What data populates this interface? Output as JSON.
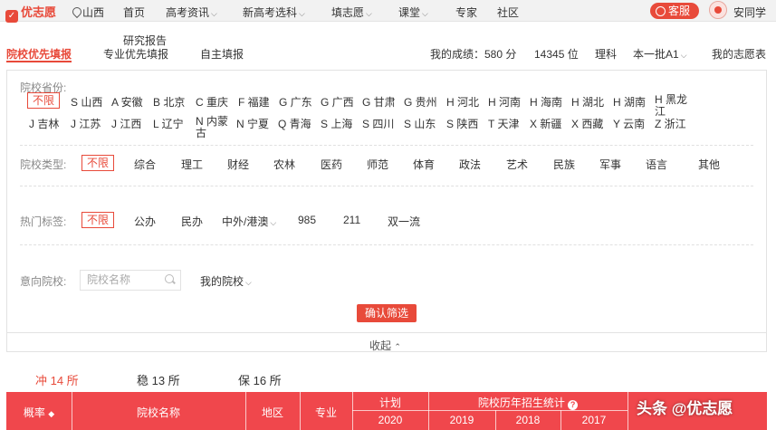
{
  "topbar": {
    "logo": "优志愿",
    "location": "山西",
    "nav": [
      {
        "label": "首页",
        "dropdown": false
      },
      {
        "label": "高考资讯",
        "dropdown": true
      },
      {
        "label": "新高考选科",
        "dropdown": true
      },
      {
        "label": "填志愿",
        "dropdown": true
      },
      {
        "label": "课堂",
        "dropdown": true
      },
      {
        "label": "专家",
        "dropdown": false
      },
      {
        "label": "社区",
        "dropdown": false
      }
    ],
    "service": "客服",
    "username": "安同学"
  },
  "tabs": {
    "school_first": "院校优先填报",
    "major_first_top": "研究报告",
    "major_first": "专业优先填报",
    "self_fill": "自主填报"
  },
  "info": {
    "score": "我的成绩：580 分",
    "rank": "14345 位",
    "subject": "理科",
    "batch": "本一批A1",
    "my_volunteer": "我的志愿表"
  },
  "filter": {
    "province_label": "院校省份:",
    "unlimited": "不限",
    "provinces_row1": [
      "S 山西",
      "A 安徽",
      "B 北京",
      "C 重庆",
      "F 福建",
      "G 广东",
      "G 广西",
      "G 甘肃",
      "G 贵州",
      "H 河北",
      "H 河南",
      "H 海南",
      "H 湖北",
      "H 湖南",
      "H 黑龙江"
    ],
    "provinces_row2": [
      "J 吉林",
      "J 江苏",
      "J 江西",
      "L 辽宁",
      "N 内蒙古",
      "N 宁夏",
      "Q 青海",
      "S 上海",
      "S 四川",
      "S 山东",
      "S 陕西",
      "T 天津",
      "X 新疆",
      "X 西藏",
      "Y 云南",
      "Z 浙江"
    ],
    "type_label": "院校类型:",
    "types": [
      "综合",
      "理工",
      "财经",
      "农林",
      "医药",
      "师范",
      "体育",
      "政法",
      "艺术",
      "民族",
      "军事",
      "语言",
      "其他"
    ],
    "tag_label": "热门标签:",
    "tags": [
      "公办",
      "民办",
      "中外/港澳",
      "985",
      "211",
      "双一流"
    ],
    "intent_label": "意向院校:",
    "search_placeholder": "院校名称",
    "my_schools": "我的院校",
    "confirm": "确认筛选",
    "collapse": "收起"
  },
  "stats": {
    "rush": "冲 14 所",
    "steady": "稳 13 所",
    "safe": "保 16 所"
  },
  "table": {
    "probability": "概率",
    "school_name": "院校名称",
    "region": "地区",
    "major": "专业",
    "plan": "计划",
    "plan_year": "2020",
    "history": "院校历年招生统计",
    "years": [
      "2019",
      "2018",
      "2017"
    ]
  },
  "watermark": "头条 @优志愿",
  "colors": {
    "accent": "#e84a3a",
    "table_header": "#f0474c"
  }
}
